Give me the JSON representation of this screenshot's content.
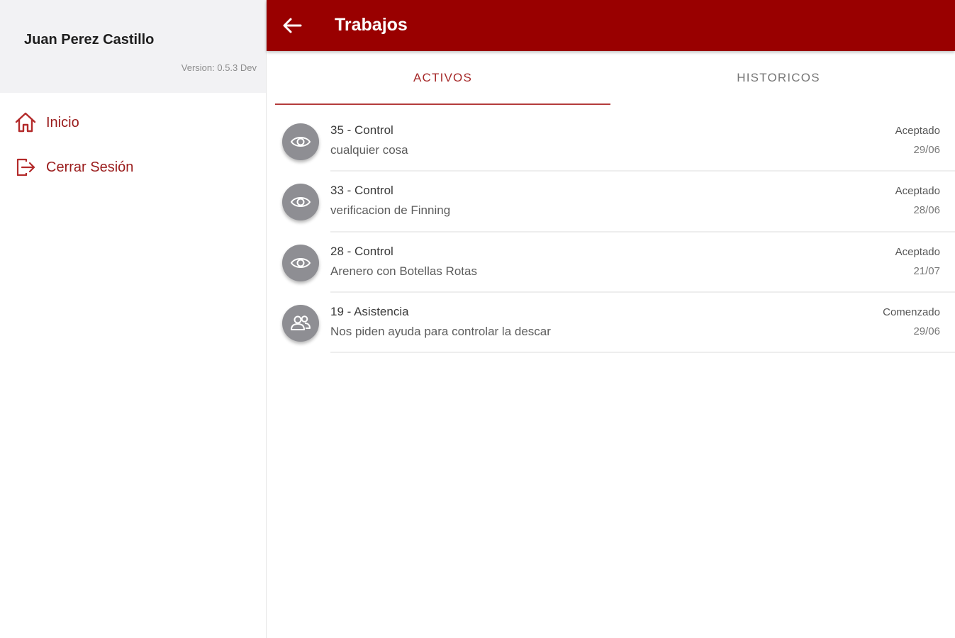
{
  "sidebar": {
    "user_name": "Juan Perez Castillo",
    "version": "Version: 0.5.3 Dev",
    "items": [
      {
        "label": "Inicio",
        "icon": "home-icon"
      },
      {
        "label": "Cerrar Sesión",
        "icon": "logout-icon"
      }
    ]
  },
  "appbar": {
    "title": "Trabajos",
    "back_icon": "arrow-left-icon",
    "color": "#990000"
  },
  "tabs": [
    {
      "label": "ACTIVOS",
      "active": true
    },
    {
      "label": "HISTORICOS",
      "active": false
    }
  ],
  "jobs": [
    {
      "title": "35 - Control",
      "subtitle": "cualquier cosa",
      "status": "Aceptado",
      "date": "29/06",
      "icon": "eye-icon"
    },
    {
      "title": "33 - Control",
      "subtitle": "verificacion de Finning",
      "status": "Aceptado",
      "date": "28/06",
      "icon": "eye-icon"
    },
    {
      "title": "28 - Control",
      "subtitle": "Arenero con Botellas Rotas",
      "status": "Aceptado",
      "date": "21/07",
      "icon": "eye-icon"
    },
    {
      "title": "19 - Asistencia",
      "subtitle": "Nos piden ayuda para controlar la descar",
      "status": "Comenzado",
      "date": "29/06",
      "icon": "people-icon"
    }
  ],
  "colors": {
    "accent": "#990000",
    "nav_text": "#9a1c1c",
    "avatar": "#8e8e93"
  }
}
